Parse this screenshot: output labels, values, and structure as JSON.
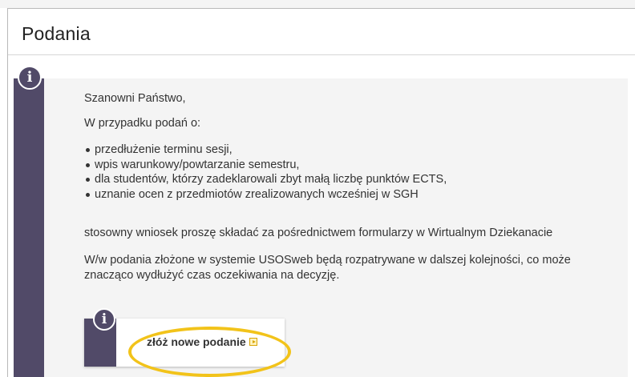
{
  "page": {
    "title": "Podania"
  },
  "notice": {
    "icon": "info-icon",
    "greeting": "Szanowni Państwo,",
    "intro": "W przypadku podań o:",
    "bullets": [
      "przedłużenie terminu sesji,",
      "wpis warunkowy/powtarzanie semestru,",
      "dla studentów, którzy zadeklarowali zbyt małą liczbę punktów ECTS,",
      "uznanie ocen z przedmiotów zrealizowanych wcześniej w SGH"
    ],
    "instruction": "stosowny wniosek proszę składać za pośrednictwem formularzy w Wirtualnym Dziekanacie",
    "note": "W/w podania złożone w systemie USOSweb będą rozpatrywane w dalszej kolejności, co może znacząco wydłużyć czas oczekiwania na decyzję."
  },
  "action": {
    "icon": "info-icon",
    "new_application_label": "złóż nowe podanie",
    "link_icon": "arrow-right-square-icon"
  },
  "colors": {
    "accent": "#514a68",
    "highlight": "#f2c31a",
    "notice_background": "#f4f4f4"
  }
}
